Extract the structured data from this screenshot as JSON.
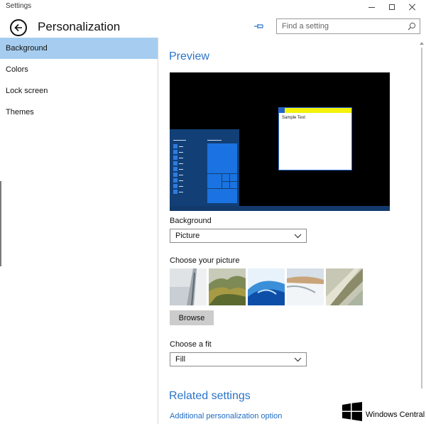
{
  "window": {
    "title": "Settings",
    "controls": [
      "minimize",
      "maximize",
      "close"
    ]
  },
  "header": {
    "back_icon": "back-arrow-icon",
    "title": "Personalization",
    "pin_icon": "pin-icon",
    "search": {
      "placeholder": "Find a setting",
      "value": "",
      "icon": "search-icon"
    }
  },
  "sidebar": {
    "items": [
      {
        "label": "Background",
        "active": true
      },
      {
        "label": "Colors",
        "active": false
      },
      {
        "label": "Lock screen",
        "active": false
      },
      {
        "label": "Themes",
        "active": false
      }
    ]
  },
  "main": {
    "preview": {
      "heading": "Preview",
      "sample_text": "Sample Text"
    },
    "background": {
      "label": "Background",
      "selected": "Picture"
    },
    "choose_picture": {
      "label": "Choose your picture",
      "thumbnails": [
        "bridge-fog",
        "green-mountains",
        "blue-abstract",
        "snowy-slope",
        "shoreline-aerial"
      ]
    },
    "browse_label": "Browse",
    "fit": {
      "label": "Choose a fit",
      "selected": "Fill"
    },
    "related": {
      "heading": "Related settings",
      "link": "Additional personalization option"
    }
  },
  "watermark": {
    "text": "Windows Central"
  },
  "colors": {
    "accent": "#2b74c7",
    "sidebar_active": "#a6cdf0",
    "preview_background": "#000000",
    "start_menu": "#123f76",
    "tile": "#1a73e0",
    "window_titlebar": "#f2f20a"
  }
}
